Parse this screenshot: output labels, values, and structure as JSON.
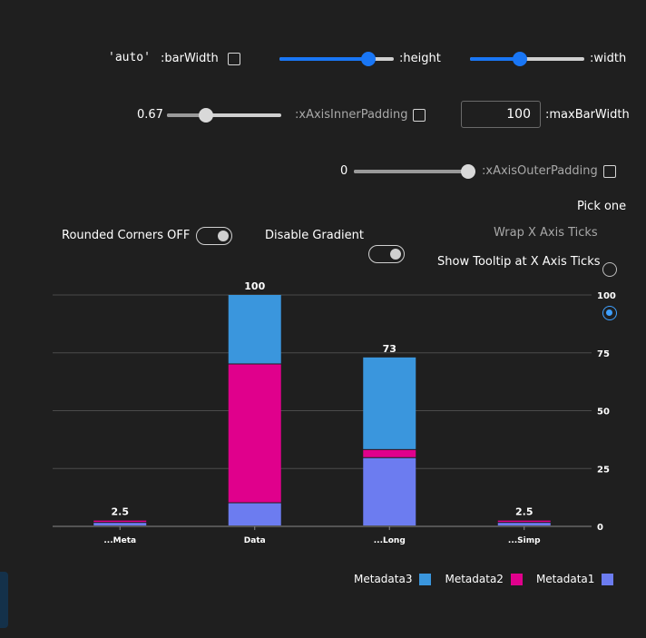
{
  "controls": {
    "barWidth_value": "'auto'",
    "barWidth_label": ":barWidth",
    "height_label": ":height",
    "height_level": 0.78,
    "width_label": ":width",
    "width_level": 0.44,
    "xAxisInnerPadding_value": "0.67",
    "xAxisInnerPadding_label": ":xAxisInnerPadding",
    "xAxisInnerPadding_level": 0.34,
    "maxBarWidth_value": "100",
    "maxBarWidth_label": ":maxBarWidth",
    "xAxisOuterPadding_value": "0",
    "xAxisOuterPadding_label": ":xAxisOuterPadding",
    "xAxisOuterPadding_level": 1.0,
    "rounded_corners_label": "Rounded Corners OFF",
    "disable_gradient_label": "Disable Gradient",
    "pick_one_label": "Pick one",
    "wrap_ticks_label": "Wrap X Axis Ticks",
    "show_tooltip_label": "Show Tooltip at X Axis Ticks"
  },
  "colors": {
    "Metadata1": "#6c7cf0",
    "Metadata2": "#e0008c",
    "Metadata3": "#3a96dd"
  },
  "chart_data": {
    "type": "bar",
    "stacked": true,
    "categories": [
      "...Meta",
      "Data",
      "...Long",
      "...Simp"
    ],
    "series": [
      {
        "name": "Metadata1",
        "values": [
          1.5,
          10,
          29.5,
          1.5
        ]
      },
      {
        "name": "Metadata2",
        "values": [
          1,
          60,
          3.5,
          1
        ]
      },
      {
        "name": "Metadata3",
        "values": [
          0,
          30,
          40,
          0
        ]
      }
    ],
    "totals": [
      "2.5",
      "100",
      "73",
      "2.5"
    ],
    "ylim": [
      0,
      100
    ],
    "yticks": [
      0,
      25,
      50,
      75,
      100
    ],
    "ytick_labels": [
      "0",
      "25",
      "50",
      "75",
      "100"
    ],
    "y_axis_position": "right",
    "grid": true,
    "legend_position": "bottom-right",
    "legend": [
      "Metadata3",
      "Metadata2",
      "Metadata1"
    ]
  }
}
